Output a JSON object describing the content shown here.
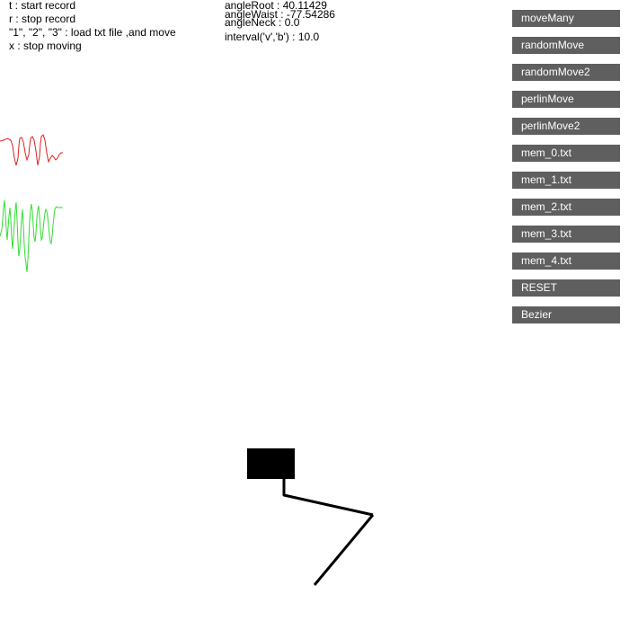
{
  "instructions": [
    "t : start record",
    "r : stop record",
    "\"1\", \"2\", \"3\" : load txt file ,and move",
    "x : stop moving"
  ],
  "readouts": {
    "angle_root": "angleRoot : 40.11429",
    "angle_waist": "angleWaist : -77.54286",
    "angle_neck": "angleNeck : 0.0",
    "interval": "interval('v','b') : 10.0"
  },
  "buttons": [
    "moveMany",
    "randomMove",
    "randomMove2",
    "perlinMove",
    "perlinMove2",
    "mem_0.txt",
    "mem_1.txt",
    "mem_2.txt",
    "mem_3.txt",
    "mem_4.txt",
    "RESET",
    "Bezier"
  ],
  "colors": {
    "button_bg": "#5f5f5f",
    "waveform_red": "#e02020",
    "waveform_green": "#33dd33",
    "arm": "#000000"
  }
}
